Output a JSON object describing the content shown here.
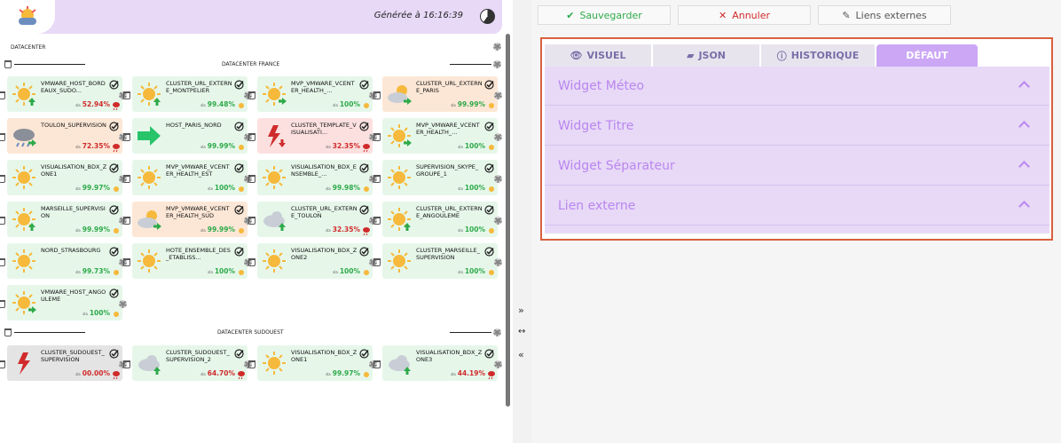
{
  "header": {
    "generated": "Générée à 16:16:39"
  },
  "sections": [
    {
      "title": "DATACENTER"
    },
    {
      "title": "DATACENTER FRANCE"
    },
    {
      "title": "DATACENTER SUDOUEST"
    }
  ],
  "tiles": [
    {
      "name": "VMWARE_HOST_BORDEAUX_SUDO...",
      "value": "52.94%",
      "bg": "#e6f7ea",
      "color": "#d02b2b",
      "weather": "sun",
      "arrow": "up"
    },
    {
      "name": "CLUSTER_URL_EXTERNE_MONTPELIER",
      "value": "99.48%",
      "bg": "#e6f7ea",
      "color": "#2eaa4a",
      "weather": "sun",
      "arrow": "up"
    },
    {
      "name": "MVP_VMWARE_VCENTER_HEALTH_...",
      "value": "100%",
      "bg": "#e6f7ea",
      "color": "#2eaa4a",
      "weather": "sun",
      "arrow": "right"
    },
    {
      "name": "CLUSTER_URL_EXTERNE_PARIS",
      "value": "99.99%",
      "bg": "#fce7d6",
      "color": "#2eaa4a",
      "weather": "cloudsun",
      "arrow": "right"
    },
    {
      "name": "TOULON_SUPERVISION",
      "value": "72.35%",
      "bg": "#fce7d6",
      "color": "#d02b2b",
      "weather": "rain",
      "arrow": "right"
    },
    {
      "name": "HOST_PARIS_NORD",
      "value": "99.99%",
      "bg": "#e6f7ea",
      "color": "#2eaa4a",
      "weather": "bigarrow",
      "arrow": "none"
    },
    {
      "name": "CLUSTER_TEMPLATE_VISUALISATI...",
      "value": "32.35%",
      "bg": "#fce0e0",
      "color": "#d02b2b",
      "weather": "storm",
      "arrow": "down"
    },
    {
      "name": "MVP_VMWARE_VCENTER_HEALTH_...",
      "value": "100%",
      "bg": "#e6f7ea",
      "color": "#2eaa4a",
      "weather": "sun",
      "arrow": "right"
    },
    {
      "name": "VISUALISATION_BDX_ZONE1",
      "value": "99.97%",
      "bg": "#e6f7ea",
      "color": "#2eaa4a",
      "weather": "sun",
      "arrow": "none"
    },
    {
      "name": "MVP_VMWARE_VCENTER_HEALTH_EST",
      "value": "100%",
      "bg": "#e6f7ea",
      "color": "#2eaa4a",
      "weather": "sun",
      "arrow": "none"
    },
    {
      "name": "VISUALISATION_BDX_ENSEMBLE_...",
      "value": "99.98%",
      "bg": "#e6f7ea",
      "color": "#2eaa4a",
      "weather": "sun",
      "arrow": "none"
    },
    {
      "name": "SUPERVISION_SKYPE_GROUPE_1",
      "value": "100%",
      "bg": "#e6f7ea",
      "color": "#2eaa4a",
      "weather": "sun",
      "arrow": "none"
    },
    {
      "name": "MARSEILLE_SUPERVISION",
      "value": "99.99%",
      "bg": "#e6f7ea",
      "color": "#2eaa4a",
      "weather": "sun",
      "arrow": "up"
    },
    {
      "name": "MVP_VMWARE_VCENTER_HEALTH_SUD",
      "value": "99.99%",
      "bg": "#fce7d6",
      "color": "#2eaa4a",
      "weather": "cloudsun",
      "arrow": "right"
    },
    {
      "name": "CLUSTER_URL_EXTERNE_TOULON",
      "value": "32.35%",
      "bg": "#e6f7ea",
      "color": "#d02b2b",
      "weather": "cloud",
      "arrow": "up"
    },
    {
      "name": "CLUSTER_URL_EXTERNE_ANGOULEME",
      "value": "100%",
      "bg": "#e6f7ea",
      "color": "#2eaa4a",
      "weather": "sun",
      "arrow": "up"
    },
    {
      "name": "NORD_STRASBOURG",
      "value": "99.73%",
      "bg": "#e6f7ea",
      "color": "#2eaa4a",
      "weather": "sun",
      "arrow": "none"
    },
    {
      "name": "HOTE_ENSEMBLE_DES_ETABLISS...",
      "value": "100%",
      "bg": "#e6f7ea",
      "color": "#2eaa4a",
      "weather": "sun",
      "arrow": "none"
    },
    {
      "name": "VISUALISATION_BDX_ZONE2",
      "value": "100%",
      "bg": "#e6f7ea",
      "color": "#2eaa4a",
      "weather": "sun",
      "arrow": "none"
    },
    {
      "name": "CLUSTER_MARSEILLE_SUPERVISION",
      "value": "100%",
      "bg": "#e6f7ea",
      "color": "#2eaa4a",
      "weather": "sun",
      "arrow": "none"
    },
    {
      "name": "VMWARE_HOST_ANGOULEME",
      "value": "100%",
      "bg": "#e6f7ea",
      "color": "#2eaa4a",
      "weather": "sun",
      "arrow": "right"
    },
    {
      "name": "CLUSTER_SUDOUEST_SUPERVISION",
      "value": "00.00%",
      "bg": "#e4e4e4",
      "color": "#d02b2b",
      "weather": "storm",
      "arrow": "none"
    },
    {
      "name": "CLUSTER_SUDOUEST_SUPERVISION_2",
      "value": "64.70%",
      "bg": "#e6f7ea",
      "color": "#d02b2b",
      "weather": "cloud",
      "arrow": "up"
    },
    {
      "name": "VISUALISATION_BDX_ZONE1",
      "value": "99.97%",
      "bg": "#e6f7ea",
      "color": "#2eaa4a",
      "weather": "sun",
      "arrow": "none"
    },
    {
      "name": "VISUALISATION_BDX_ZONE3",
      "value": "44.19%",
      "bg": "#e6f7ea",
      "color": "#d02b2b",
      "weather": "cloud",
      "arrow": "up"
    }
  ],
  "toolbar": {
    "save": "Sauvegarder",
    "cancel": "Annuler",
    "links": "Liens externes"
  },
  "tabs": [
    {
      "label": "VISUEL"
    },
    {
      "label": "JSON"
    },
    {
      "label": "HISTORIQUE"
    },
    {
      "label": "DÉFAUT",
      "active": true
    }
  ],
  "accordion": [
    {
      "label": "Widget Méteo"
    },
    {
      "label": "Widget Titre"
    },
    {
      "label": "Widget Séparateur"
    },
    {
      "label": "Lien externe"
    }
  ],
  "colors": {
    "accent": "#cba7f5",
    "accent_text": "#b987ee",
    "header_bg": "#e8d9f7",
    "ok": "#2eaa4a",
    "bad": "#d02b2b",
    "highlight": "#d9603f"
  }
}
